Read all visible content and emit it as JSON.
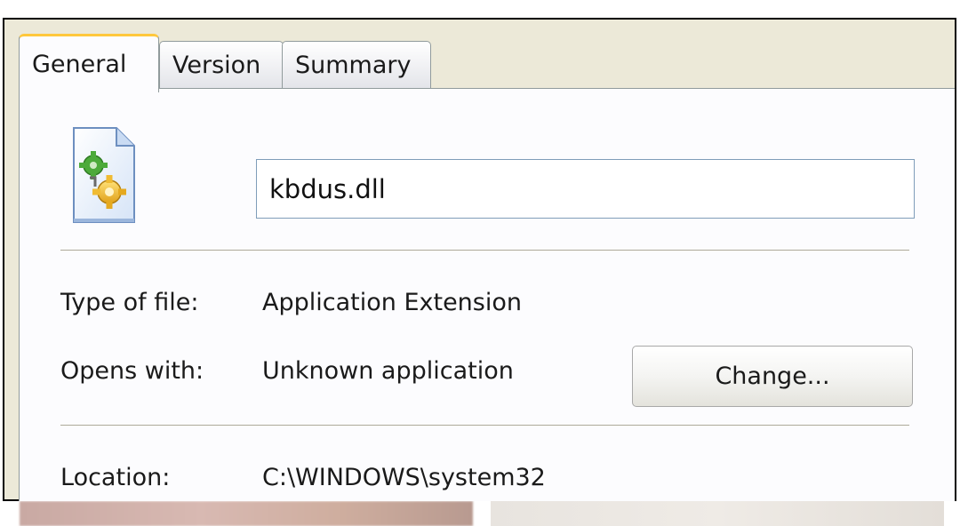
{
  "tabs": [
    {
      "label": "General",
      "active": true
    },
    {
      "label": "Version",
      "active": false
    },
    {
      "label": "Summary",
      "active": false
    }
  ],
  "file": {
    "icon": "dll-file-icon",
    "name": "kbdus.dll"
  },
  "properties": {
    "type_label": "Type of file:",
    "type_value": "Application Extension",
    "opens_label": "Opens with:",
    "opens_value": "Unknown application",
    "change_label": "Change...",
    "location_label": "Location:",
    "location_value": "C:\\WINDOWS\\system32"
  },
  "colors": {
    "active_tab_accent": "#ffc83c",
    "panel_background": "#fcfcfe",
    "dialog_background": "#ece9d8",
    "input_border": "#7f9db9"
  }
}
